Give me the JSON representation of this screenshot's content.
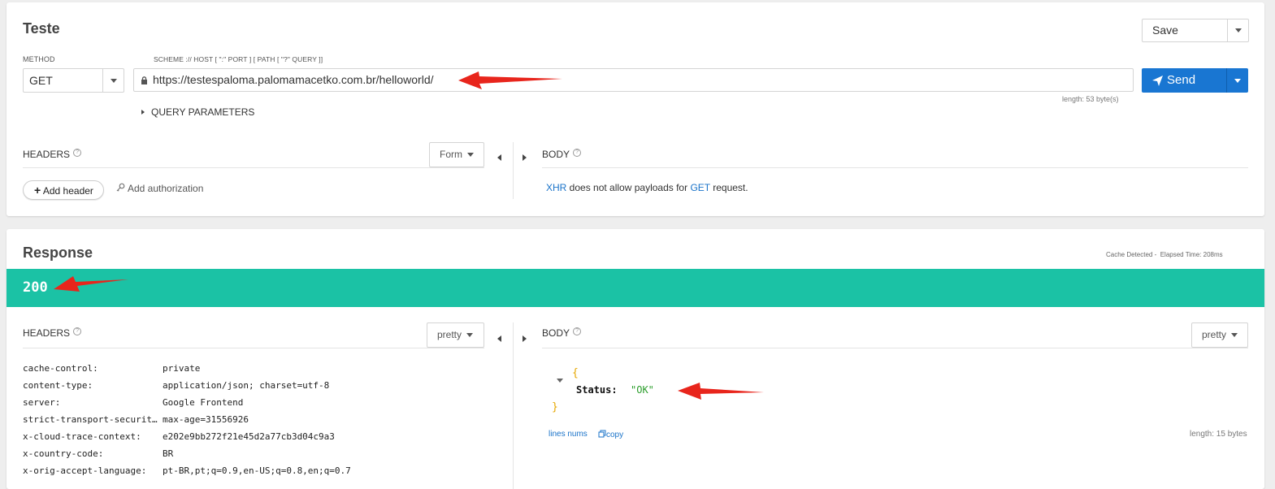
{
  "request": {
    "title": "Teste",
    "save_label": "Save",
    "method_label": "METHOD",
    "method_value": "GET",
    "url_label": "SCHEME :// HOST [ \":\" PORT ] [ PATH [ \"?\" QUERY ]]",
    "url_value": "https://testespaloma.palomamacetko.com.br/helloworld/",
    "url_length": "length: 53 byte(s)",
    "send_label": "Send",
    "query_params_label": "QUERY PARAMETERS",
    "headers_label": "HEADERS",
    "help_glyph": "?",
    "form_label": "Form",
    "body_label": "BODY",
    "add_header_label": "Add header",
    "add_auth_label": "Add authorization",
    "body_msg_xhr": "XHR",
    "body_msg_mid": " does not allow payloads for ",
    "body_msg_get": "GET",
    "body_msg_end": " request."
  },
  "response": {
    "title": "Response",
    "cache_info": "Cache Detected -  Elapsed Time: 208ms",
    "status_code": "200",
    "status_color": "#1bc2a5",
    "headers_label": "HEADERS",
    "pretty_label": "pretty",
    "body_label": "BODY",
    "body_pretty_label": "pretty",
    "headers": [
      {
        "name": "cache-control:",
        "value": "private"
      },
      {
        "name": "content-type:",
        "value": "application/json; charset=utf-8"
      },
      {
        "name": "server:",
        "value": "Google Frontend"
      },
      {
        "name": "strict-transport-securit…",
        "value": "max-age=31556926"
      },
      {
        "name": "x-cloud-trace-context:",
        "value": "e202e9bb272f21e45d2a77cb3d04c9a3"
      },
      {
        "name": "x-country-code:",
        "value": "BR"
      },
      {
        "name": "x-orig-accept-language:",
        "value": "pt-BR,pt;q=0.9,en-US;q=0.8,en;q=0.7"
      }
    ],
    "json_open": "{",
    "json_key": "Status:",
    "json_value": "\"OK\"",
    "json_close": "}",
    "line_nums_label": "lines nums",
    "copy_label": "copy",
    "body_length": "length: 15 bytes"
  },
  "colors": {
    "accent_blue": "#1976d2",
    "status_green": "#1bc2a5",
    "annotation_red": "#e8251c",
    "json_brace": "#e6a700",
    "json_string": "#2a9d2a"
  },
  "icons": [
    "lock-icon",
    "send-icon",
    "plus-icon",
    "key-icon",
    "copy-icon",
    "chevron-down-icon",
    "triangle-left-icon",
    "triangle-right-icon",
    "help-icon"
  ]
}
